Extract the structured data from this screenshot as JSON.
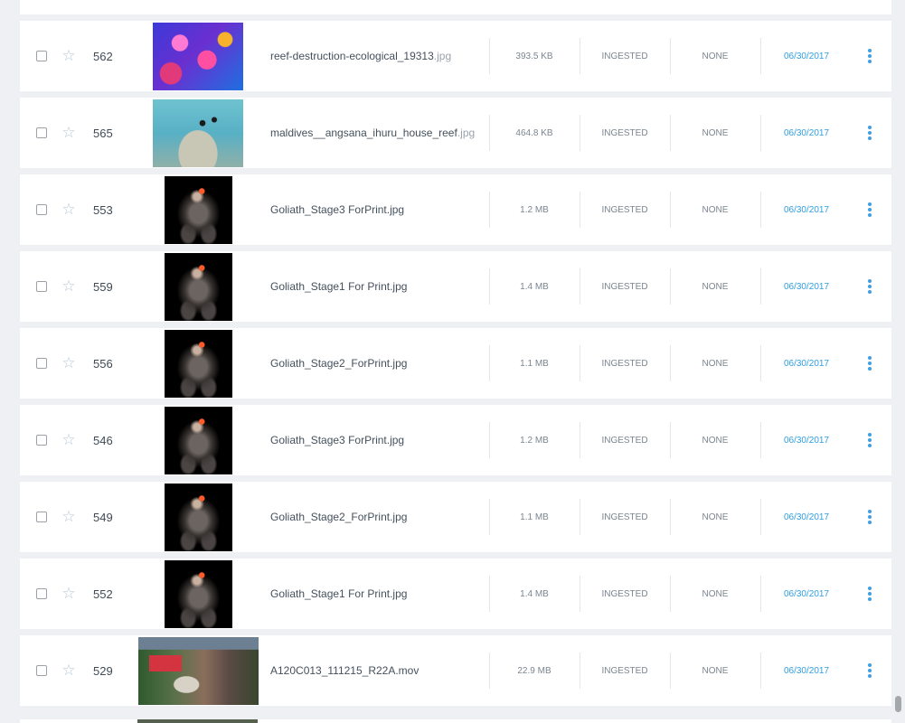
{
  "icons": {
    "star": "☆",
    "more": "more-vertical-icon"
  },
  "colors": {
    "date_link": "#2f9ee0",
    "more_icon": "#3f9fe0"
  },
  "rows": [
    {
      "id": "",
      "file": "",
      "ext": "",
      "size": "",
      "status": "",
      "none": "",
      "date": "",
      "thumb": "reeftop"
    },
    {
      "id": "562",
      "file": "reef-destruction-ecological_19313",
      "ext": ".jpg",
      "size": "393.5 KB",
      "status": "INGESTED",
      "none": "NONE",
      "date": "06/30/2017",
      "thumb": "reef1"
    },
    {
      "id": "565",
      "file": "maldives__angsana_ihuru_house_reef",
      "ext": ".jpg",
      "size": "464.8 KB",
      "status": "INGESTED",
      "none": "NONE",
      "date": "06/30/2017",
      "thumb": "reef2"
    },
    {
      "id": "553",
      "file": "Goliath_Stage3 ForPrint.jpg",
      "ext": "",
      "size": "1.2 MB",
      "status": "INGESTED",
      "none": "NONE",
      "date": "06/30/2017",
      "thumb": "monster"
    },
    {
      "id": "559",
      "file": "Goliath_Stage1 For Print.jpg",
      "ext": "",
      "size": "1.4 MB",
      "status": "INGESTED",
      "none": "NONE",
      "date": "06/30/2017",
      "thumb": "monster"
    },
    {
      "id": "556",
      "file": "Goliath_Stage2_ForPrint.jpg",
      "ext": "",
      "size": "1.1 MB",
      "status": "INGESTED",
      "none": "NONE",
      "date": "06/30/2017",
      "thumb": "monster"
    },
    {
      "id": "546",
      "file": "Goliath_Stage3 ForPrint.jpg",
      "ext": "",
      "size": "1.2 MB",
      "status": "INGESTED",
      "none": "NONE",
      "date": "06/30/2017",
      "thumb": "monster"
    },
    {
      "id": "549",
      "file": "Goliath_Stage2_ForPrint.jpg",
      "ext": "",
      "size": "1.1 MB",
      "status": "INGESTED",
      "none": "NONE",
      "date": "06/30/2017",
      "thumb": "monster"
    },
    {
      "id": "552",
      "file": "Goliath_Stage1 For Print.jpg",
      "ext": "",
      "size": "1.4 MB",
      "status": "INGESTED",
      "none": "NONE",
      "date": "06/30/2017",
      "thumb": "monster"
    },
    {
      "id": "529",
      "file": "A120C013_111215_R22A.mov",
      "ext": "",
      "size": "22.9 MB",
      "status": "INGESTED",
      "none": "NONE",
      "date": "06/30/2017",
      "thumb": "mov"
    }
  ]
}
